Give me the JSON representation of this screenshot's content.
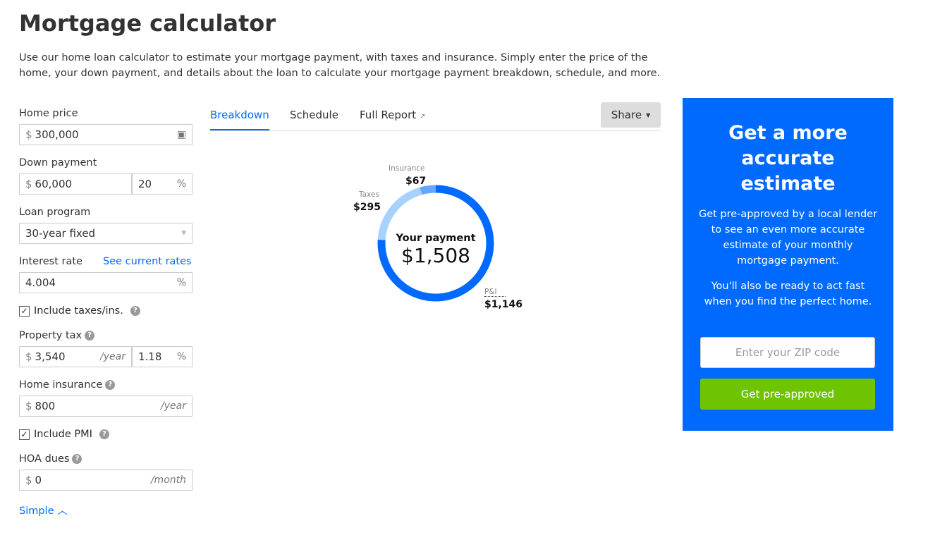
{
  "title": "Mortgage calculator",
  "intro": "Use our home loan calculator to estimate your mortgage payment, with taxes and insurance. Simply enter the price of the home, your down payment, and details about the loan to calculate your mortgage payment breakdown, schedule, and more.",
  "form": {
    "home_price_label": "Home price",
    "home_price": "300,000",
    "currency": "$",
    "down_payment_label": "Down payment",
    "down_payment": "60,000",
    "down_pct": "20",
    "pct": "%",
    "loan_program_label": "Loan program",
    "loan_program": "30-year fixed",
    "interest_label": "Interest rate",
    "see_rates": "See current rates",
    "interest": "4.004",
    "include_taxes": "Include taxes/ins.",
    "property_tax_label": "Property tax",
    "property_tax": "3,540",
    "per_year": "/year",
    "property_tax_pct": "1.18",
    "home_insurance_label": "Home insurance",
    "home_insurance": "800",
    "include_pmi": "Include PMI",
    "hoa_label": "HOA dues",
    "hoa": "0",
    "per_month": "/month",
    "simple": "Simple",
    "help": "?"
  },
  "tabs": [
    "Breakdown",
    "Schedule",
    "Full Report"
  ],
  "share": "Share",
  "chart_data": {
    "type": "pie",
    "center_label": "Your payment",
    "total": "$1,508",
    "slices": [
      {
        "name": "P&I",
        "value": 1146,
        "label": "$1,146",
        "color": "#006aff"
      },
      {
        "name": "Taxes",
        "value": 295,
        "label": "$295",
        "color": "#a9d1ff"
      },
      {
        "name": "Insurance",
        "value": 67,
        "label": "$67",
        "color": "#62a8ff"
      }
    ]
  },
  "cta": {
    "title": "Get a more accurate estimate",
    "p1": "Get pre-approved by a local lender to see an even more accurate estimate of your monthly mortgage payment.",
    "p2": "You'll also be ready to act fast when you find the perfect home.",
    "zip_placeholder": "Enter your ZIP code",
    "button": "Get pre-approved"
  }
}
